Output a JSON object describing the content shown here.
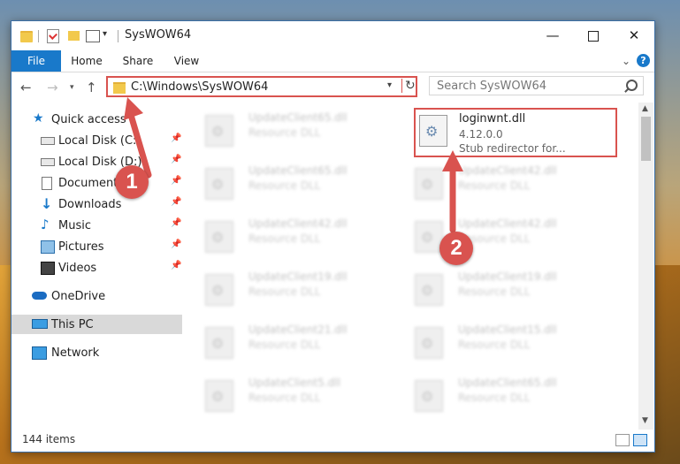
{
  "window": {
    "title": "SysWOW64"
  },
  "ribbon": {
    "tabs": [
      "File",
      "Home",
      "Share",
      "View"
    ]
  },
  "address": {
    "path": "C:\\Windows\\SysWOW64",
    "search_placeholder": "Search SysWOW64"
  },
  "sidebar": {
    "items": [
      {
        "label": "Quick access",
        "icon": "star-icon"
      },
      {
        "label": "Local Disk (C:)",
        "icon": "drive-icon",
        "pinned": true
      },
      {
        "label": "Local Disk (D:)",
        "icon": "drive-icon",
        "pinned": true
      },
      {
        "label": "Documents",
        "icon": "documents-icon",
        "pinned": true
      },
      {
        "label": "Downloads",
        "icon": "downloads-icon",
        "pinned": true
      },
      {
        "label": "Music",
        "icon": "music-icon",
        "pinned": true
      },
      {
        "label": "Pictures",
        "icon": "pictures-icon",
        "pinned": true
      },
      {
        "label": "Videos",
        "icon": "videos-icon",
        "pinned": true
      },
      {
        "label": "OneDrive",
        "icon": "onedrive-icon"
      },
      {
        "label": "This PC",
        "icon": "pc-icon",
        "selected": true
      },
      {
        "label": "Network",
        "icon": "network-icon"
      }
    ]
  },
  "files": {
    "highlighted": {
      "name": "loginwnt.dll",
      "version": "4.12.0.0",
      "description": "Stub redirector for..."
    },
    "left_column": [
      {
        "name": "UpdateClient65.dll",
        "desc": "Resource DLL"
      },
      {
        "name": "UpdateClient65.dll",
        "desc": "Resource DLL"
      },
      {
        "name": "UpdateClient42.dll",
        "desc": "Resource DLL"
      },
      {
        "name": "UpdateClient19.dll",
        "desc": "Resource DLL"
      },
      {
        "name": "UpdateClient21.dll",
        "desc": "Resource DLL"
      },
      {
        "name": "UpdateClient5.dll",
        "desc": "Resource DLL"
      }
    ],
    "right_column": [
      {
        "name": "UpdateClient42.dll",
        "desc": "Resource DLL"
      },
      {
        "name": "UpdateClient42.dll",
        "desc": "Resource DLL"
      },
      {
        "name": "UpdateClient19.dll",
        "desc": "Resource DLL"
      },
      {
        "name": "UpdateClient15.dll",
        "desc": "Resource DLL"
      },
      {
        "name": "UpdateClient65.dll",
        "desc": "Resource DLL"
      }
    ]
  },
  "status": {
    "item_count": "144 items"
  },
  "annotations": {
    "badge1": "1",
    "badge2": "2",
    "color": "#d9534f"
  },
  "colors": {
    "accent": "#1979ca",
    "highlight": "#d9534f"
  }
}
